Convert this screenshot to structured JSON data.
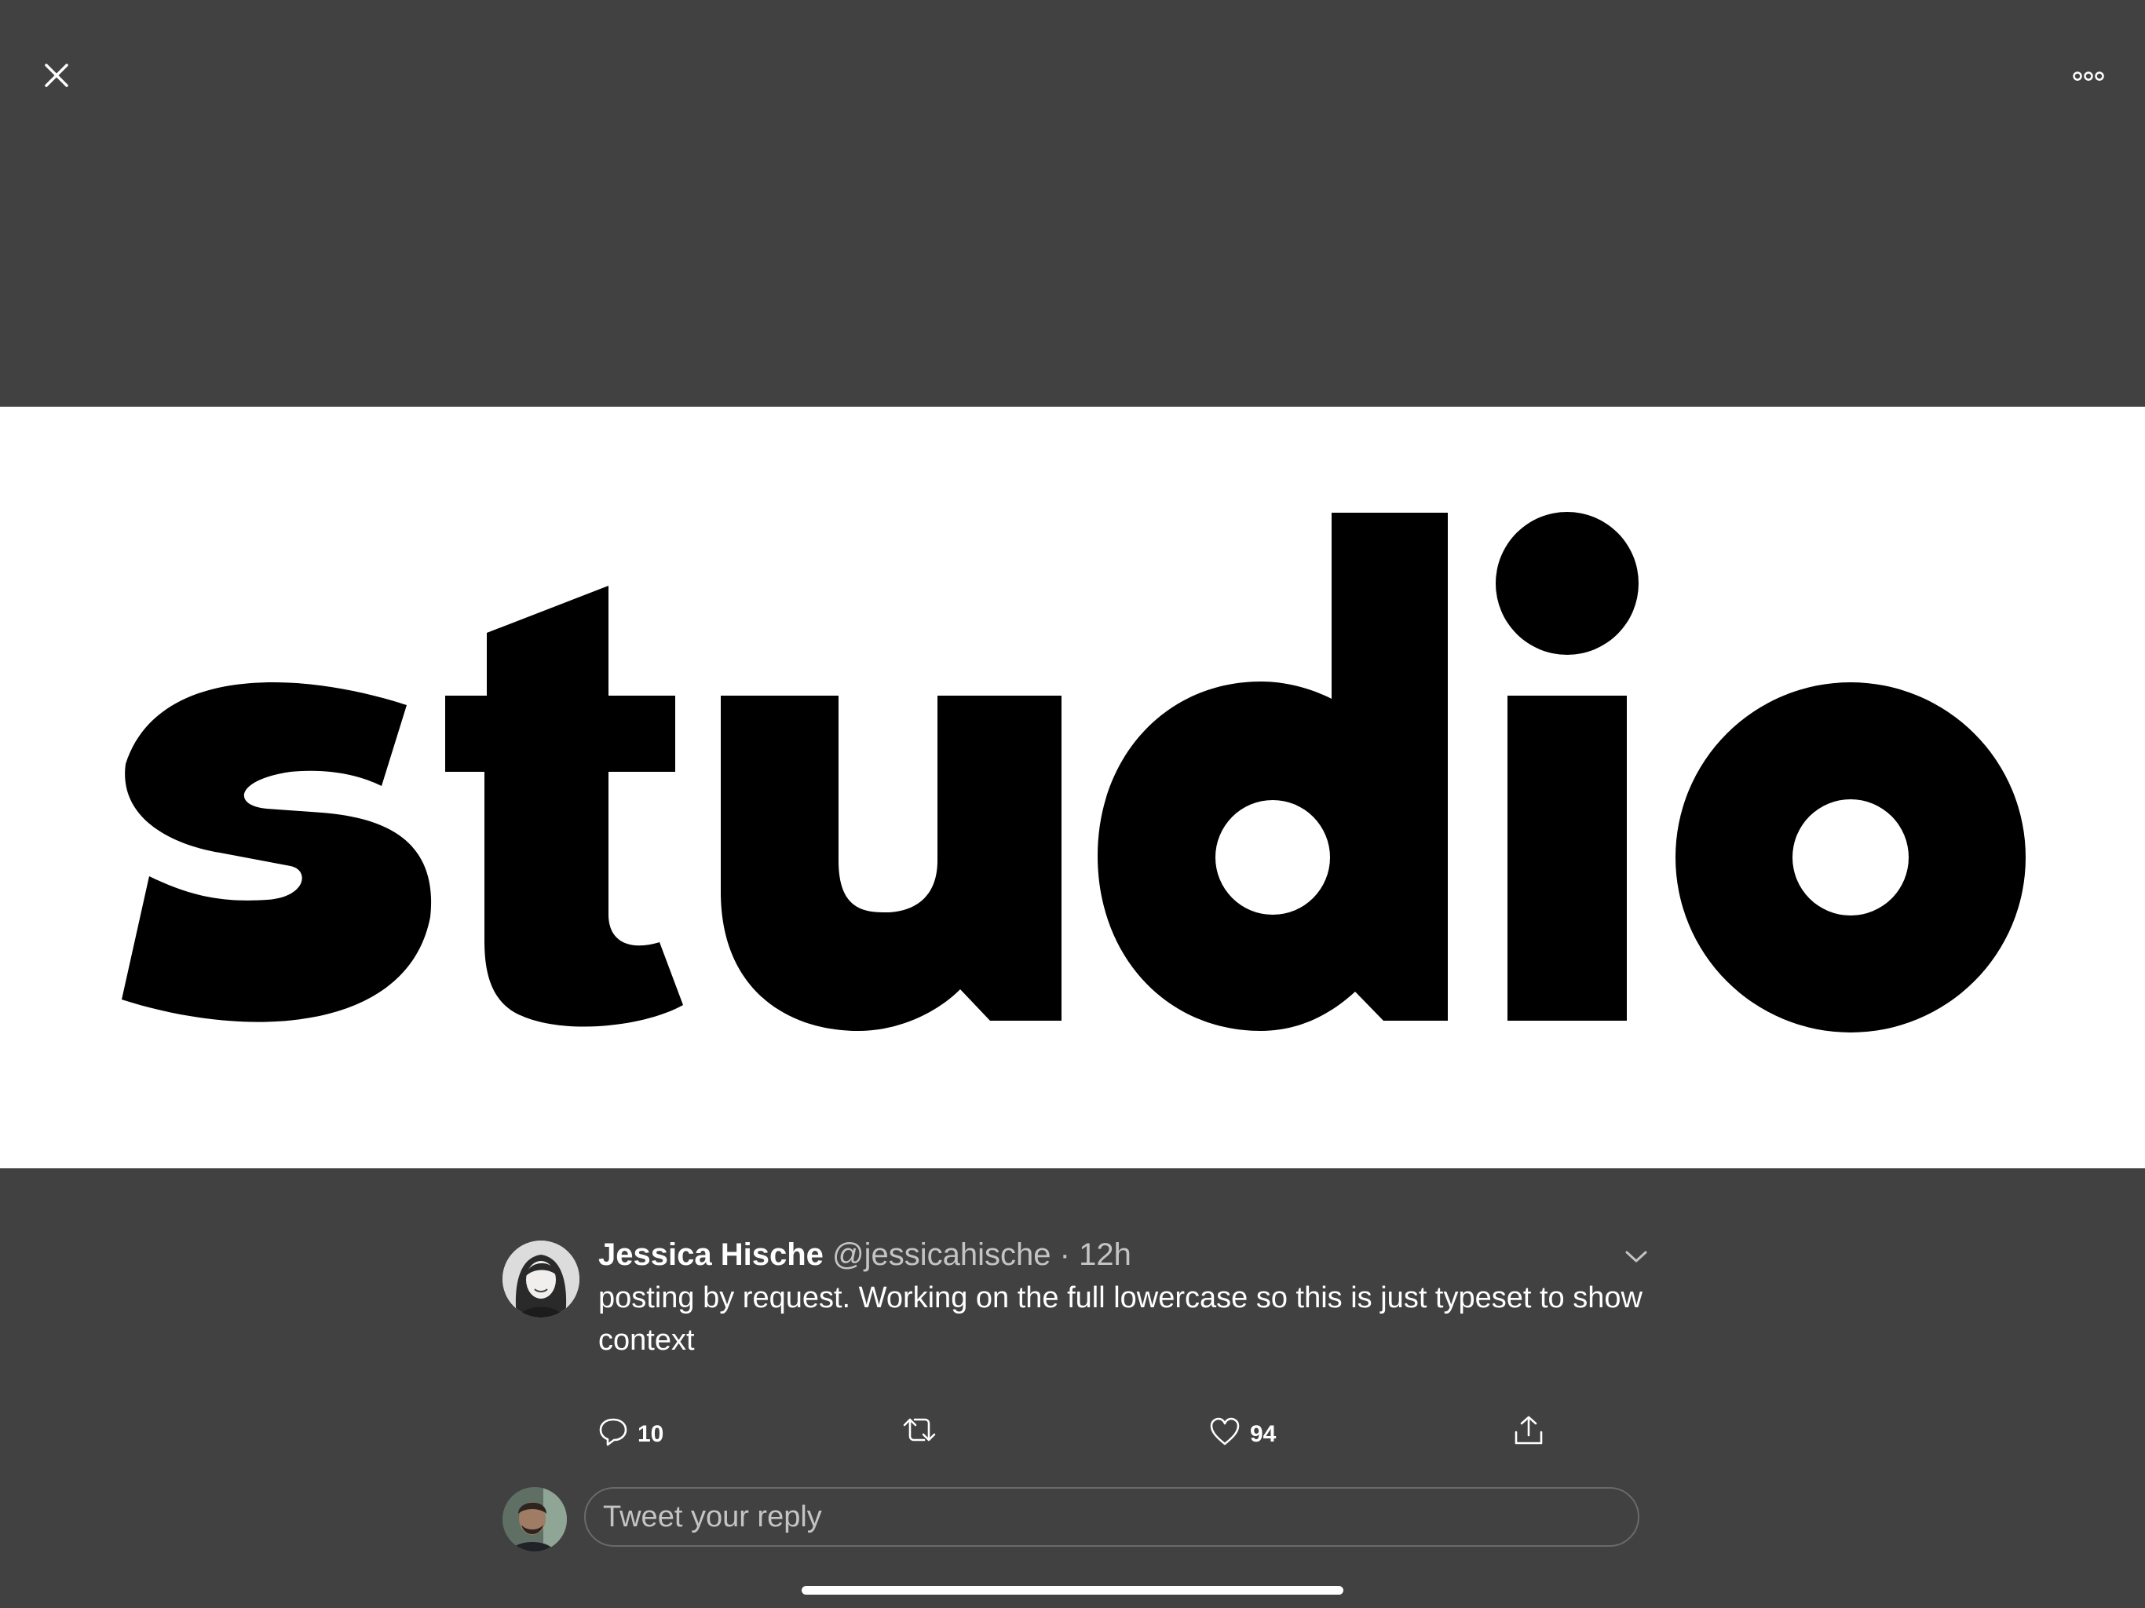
{
  "top_bar": {
    "close_icon": "close-icon",
    "more_icon": "more-options-icon"
  },
  "media": {
    "image_text": "studio",
    "background": "#ffffff",
    "text_color": "#000000"
  },
  "tweet": {
    "author_name": "Jessica Hische",
    "handle": "@jessicahische",
    "separator": "·",
    "time": "12h",
    "text": "posting by request. Working on the full lowercase so this is just typeset to show context",
    "actions": {
      "reply_count": "10",
      "like_count": "94"
    }
  },
  "reply": {
    "placeholder": "Tweet your reply"
  },
  "colors": {
    "background": "#414141",
    "secondary_text": "#c4c4c4"
  }
}
